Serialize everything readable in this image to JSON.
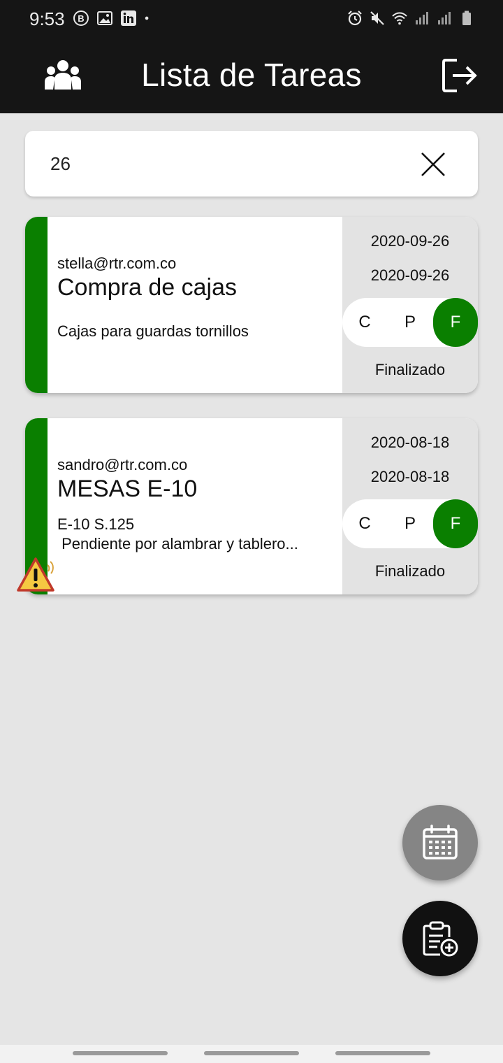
{
  "status": {
    "time": "9:53"
  },
  "header": {
    "title": "Lista de Tareas",
    "users_icon": "group-icon",
    "logout_icon": "logout-icon"
  },
  "search": {
    "value": "26",
    "clear_icon": "close-icon"
  },
  "tasks": [
    {
      "email": "stella@rtr.com.co",
      "title": "Compra de cajas",
      "description": "Cajas para guardas tornillos",
      "description_line2": "",
      "date_start": "2020-09-26",
      "date_end": "2020-09-26",
      "states": [
        "C",
        "P",
        "F"
      ],
      "selected_state": "F",
      "status_text": "Finalizado",
      "stripe_color": "#0a7f00"
    },
    {
      "email": "sandro@rtr.com.co",
      "title": "MESAS E-10",
      "description": "E-10 S.125",
      "description_line2": " Pendiente por alambrar y tablero...",
      "date_start": "2020-08-18",
      "date_end": "2020-08-18",
      "states": [
        "C",
        "P",
        "F"
      ],
      "selected_state": "F",
      "status_text": "Finalizado",
      "stripe_color": "#0a7f00",
      "alert_icon": "warning-icon"
    }
  ],
  "fabs": {
    "calendar_icon": "calendar-icon",
    "add_task_icon": "add-task-icon"
  },
  "colors": {
    "accent_green": "#0a7f00",
    "bar_dark": "#151515",
    "background": "#e5e5e5"
  }
}
